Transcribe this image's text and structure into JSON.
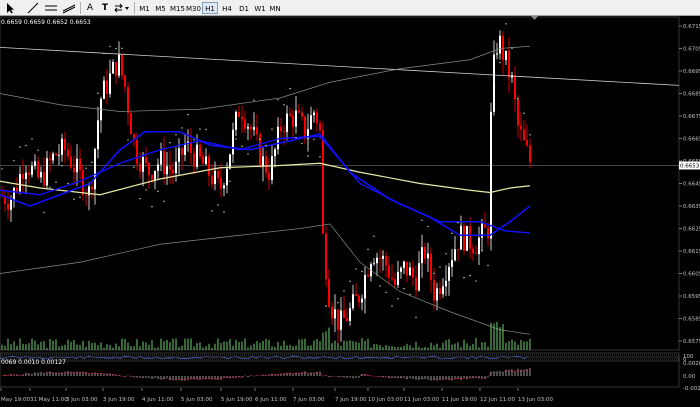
{
  "toolbar": {
    "tools": [
      {
        "name": "cursor-tool",
        "glyph": ""
      },
      {
        "name": "trendline-tool",
        "glyph": "╱"
      },
      {
        "name": "hline-tool",
        "glyph": "≡"
      },
      {
        "name": "text-tool",
        "glyph": "A"
      },
      {
        "name": "text-label-tool",
        "glyph": "T"
      },
      {
        "name": "shapes-tool",
        "glyph": "⇆"
      }
    ],
    "timeframes": [
      "M1",
      "M5",
      "M15",
      "M30",
      "H1",
      "H4",
      "D1",
      "W1",
      "MN"
    ],
    "active_timeframe": "H1"
  },
  "chart": {
    "info_line": "0.6659 0.6659 0.6652 0.6653",
    "current_price": "0.6653",
    "price_ticks": [
      "0.6715",
      "0.6705",
      "0.6695",
      "0.6685",
      "0.6675",
      "0.6665",
      "0.6655",
      "0.6645",
      "0.6635",
      "0.6625",
      "0.6615",
      "0.6605",
      "0.6595",
      "0.6585",
      "0.6575"
    ],
    "time_labels": [
      "May 19:00",
      "31 May 11:00",
      "3 Jun 03:00",
      "3 Jun 19:00",
      "4 Jun 11:00",
      "5 Jun 03:00",
      "5 Jun 19:00",
      "6 Jun 11:00",
      "7 Jun 03:00",
      "7 Jun 19:00",
      "10 Jun 03:00",
      "11 Jun 03:00",
      "11 Jun 19:00",
      "12 Jun 11:00",
      "13 Jun 03:00"
    ],
    "ylim": [
      0.6571,
      0.6719
    ]
  },
  "indicator1": {
    "ticks": [
      "100",
      "0"
    ]
  },
  "indicator2": {
    "info_line": "0069 0.0010 0.00127",
    "ticks": [
      "0.0026",
      "0.00",
      "-0.0026"
    ]
  },
  "colors": {
    "background": "#000000",
    "bull": "#ffffff",
    "bear": "#ff0000",
    "fast_ma": "#1010ff",
    "slow_ma": "#e8e8a8",
    "envelope": "#7f8f7f",
    "trendline": "#d0d0d0",
    "sar": "#c0f0c0",
    "volume": "#6fcf6f",
    "axis_text": "#c0c0c0"
  }
}
